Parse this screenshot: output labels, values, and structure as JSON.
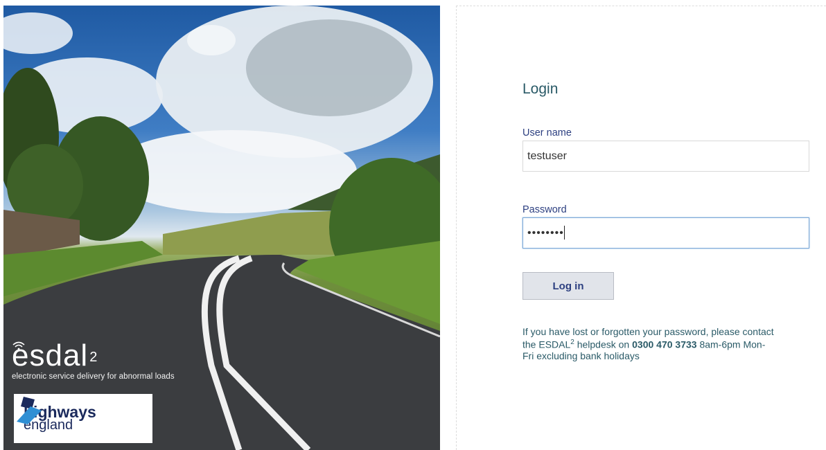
{
  "hero": {
    "brand": {
      "name": "esdal",
      "superscript": "2",
      "tagline": "electronic service delivery for abnormal loads"
    },
    "partner": {
      "line1": "highways",
      "line2": "england"
    }
  },
  "login": {
    "title": "Login",
    "username_label": "User name",
    "username_value": "testuser",
    "password_label": "Password",
    "password_value": "••••••••",
    "submit_label": "Log in"
  },
  "help": {
    "line1": "If you have lost or forgotten your password, please contact",
    "line2_prefix": "the ESDAL",
    "line2_sup": "2",
    "line2_mid": " helpdesk on ",
    "phone": "0300 470 3733",
    "line2_suffix": " 8am-6pm Mon-",
    "line3": "Fri excluding bank holidays"
  },
  "colors": {
    "accent_text": "#2a5a67",
    "label_text": "#2c3f80",
    "focus_border": "#7aa7d6",
    "button_bg": "#e1e4ea"
  }
}
